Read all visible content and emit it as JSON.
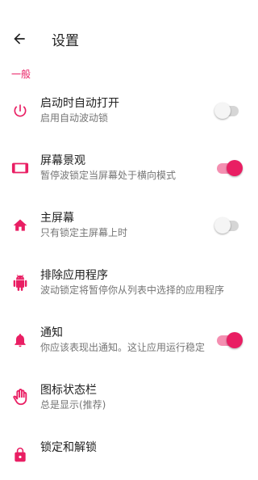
{
  "header": {
    "title": "设置"
  },
  "section": {
    "title": "一般"
  },
  "accent": "#e91e63",
  "items": [
    {
      "label": "启动时自动打开",
      "sub": "启用自动波动锁",
      "icon": "power-icon",
      "toggle": false
    },
    {
      "label": "屏幕景观",
      "sub": "暂停波锁定当屏幕处于横向模式",
      "icon": "landscape-screen-icon",
      "toggle": true
    },
    {
      "label": "主屏幕",
      "sub": "只有锁定主屏幕上时",
      "icon": "home-icon",
      "toggle": false
    },
    {
      "label": "排除应用程序",
      "sub": "波动锁定将暂停你从列表中选择的应用程序",
      "icon": "android-icon"
    },
    {
      "label": "通知",
      "sub": "你应该表现出通知。这让应用运行稳定",
      "icon": "bell-icon",
      "toggle": true
    },
    {
      "label": "图标状态栏",
      "sub": "总是显示(推荐)",
      "icon": "hand-icon"
    },
    {
      "label": "锁定和解锁",
      "sub": "",
      "icon": "lock-icon"
    }
  ]
}
